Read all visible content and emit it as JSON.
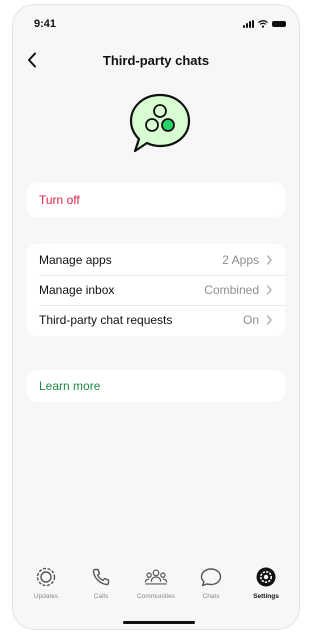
{
  "status_bar": {
    "time": "9:41"
  },
  "nav": {
    "title": "Third-party chats"
  },
  "turn_off": {
    "label": "Turn off"
  },
  "manage_section": {
    "rows": [
      {
        "label": "Manage apps",
        "value": "2 Apps"
      },
      {
        "label": "Manage inbox",
        "value": "Combined"
      },
      {
        "label": "Third-party chat requests",
        "value": "On"
      }
    ]
  },
  "learn_more": {
    "label": "Learn more"
  },
  "tab_bar": {
    "tabs": [
      {
        "label": "Updates",
        "icon": "updates-icon"
      },
      {
        "label": "Calls",
        "icon": "phone-icon"
      },
      {
        "label": "Communities",
        "icon": "communities-icon"
      },
      {
        "label": "Chats",
        "icon": "chats-icon"
      },
      {
        "label": "Settings",
        "icon": "settings-icon",
        "active": true
      }
    ]
  },
  "colors": {
    "destructive": "#e0224a",
    "link_green": "#1d8a45",
    "hero_fill": "#d9fdd3",
    "hero_dot": "#25d366"
  }
}
